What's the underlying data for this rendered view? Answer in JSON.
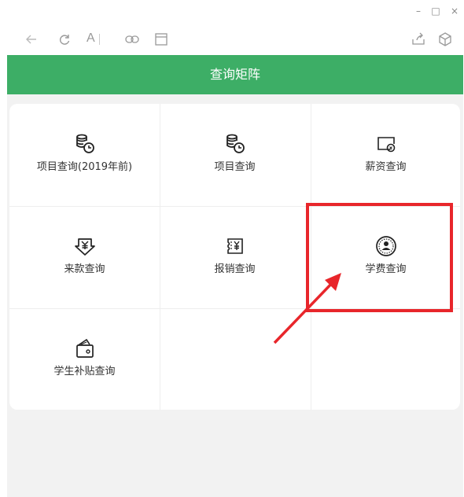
{
  "window": {
    "minimize_glyph": "–",
    "maximize_glyph": "□",
    "close_glyph": "×"
  },
  "toolbar": {
    "font_letter": "A",
    "icons": [
      "back-icon",
      "refresh-icon",
      "font-size-icon",
      "link-icon",
      "window-icon",
      "share-icon",
      "cube-icon"
    ]
  },
  "header": {
    "title": "查询矩阵",
    "bg_color": "#3dae66"
  },
  "grid": {
    "items": [
      {
        "label": "项目查询(2019年前)",
        "icon": "coins-clock-icon"
      },
      {
        "label": "项目查询",
        "icon": "coins-clock-icon"
      },
      {
        "label": "薪资查询",
        "icon": "wallet-card-icon"
      },
      {
        "label": "来款查询",
        "icon": "yen-down-arrow-icon"
      },
      {
        "label": "报销查询",
        "icon": "yen-receipt-icon"
      },
      {
        "label": "学费查询",
        "icon": "student-badge-icon"
      },
      {
        "label": "学生补贴查询",
        "icon": "open-wallet-icon"
      }
    ]
  },
  "annotation": {
    "color": "#e8262b",
    "highlighted_item": "学费查询"
  }
}
